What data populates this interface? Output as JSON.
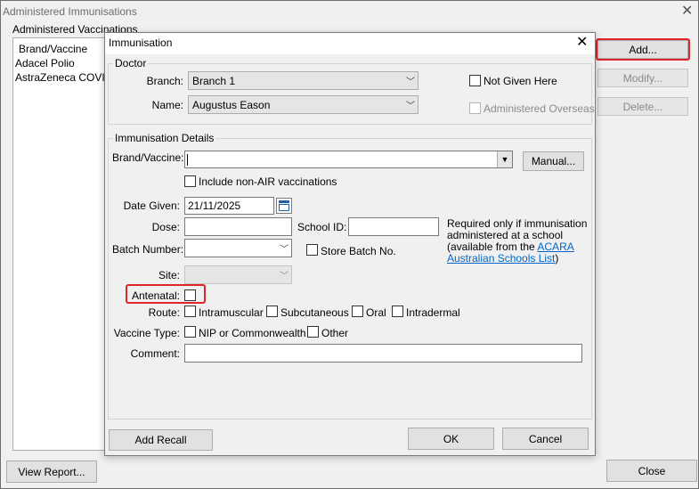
{
  "window": {
    "title": "Administered Immunisations",
    "group_label": "Administered Vaccinations",
    "list_header": "Brand/Vaccine",
    "list_items": [
      "Adacel Polio",
      "AstraZeneca COVISH"
    ],
    "buttons": {
      "add": "Add...",
      "modify": "Modify...",
      "delete": "Delete...",
      "view_report": "View Report...",
      "close": "Close"
    }
  },
  "dialog": {
    "title": "Immunisation",
    "doctor": {
      "group_label": "Doctor",
      "branch_label": "Branch:",
      "branch_value": "Branch 1",
      "name_label": "Name:",
      "name_value": "Augustus Eason",
      "not_given_here": "Not Given Here",
      "administered_overseas": "Administered Overseas"
    },
    "details": {
      "group_label": "Immunisation Details",
      "brand_label": "Brand/Vaccine:",
      "brand_value": "",
      "manual_button": "Manual...",
      "include_non_air": "Include non-AIR vaccinations",
      "date_label": "Date Given:",
      "date_value": "21/11/2025",
      "dose_label": "Dose:",
      "dose_value": "",
      "school_label": "School ID:",
      "school_value": "",
      "school_note_1": "Required only if immunisation",
      "school_note_2": "administered at a school",
      "school_note_3": "(available from the ",
      "school_note_link_1": "ACARA",
      "school_note_link_2": "Australian Schools List",
      "school_note_4": ")",
      "batch_label": "Batch Number:",
      "batch_value": "",
      "store_batch": "Store Batch No.",
      "site_label": "Site:",
      "site_value": "",
      "antenatal_label": "Antenatal:",
      "route_label": "Route:",
      "route_options": [
        "Intramuscular",
        "Subcutaneous",
        "Oral",
        "Intradermal"
      ],
      "vaccine_type_label": "Vaccine Type:",
      "vaccine_type_options": [
        "NIP or Commonwealth",
        "Other"
      ],
      "comment_label": "Comment:",
      "comment_value": ""
    },
    "buttons": {
      "add_recall": "Add Recall",
      "ok": "OK",
      "cancel": "Cancel"
    }
  },
  "colors": {
    "highlight": "#e0242b",
    "link": "#0066cc"
  }
}
